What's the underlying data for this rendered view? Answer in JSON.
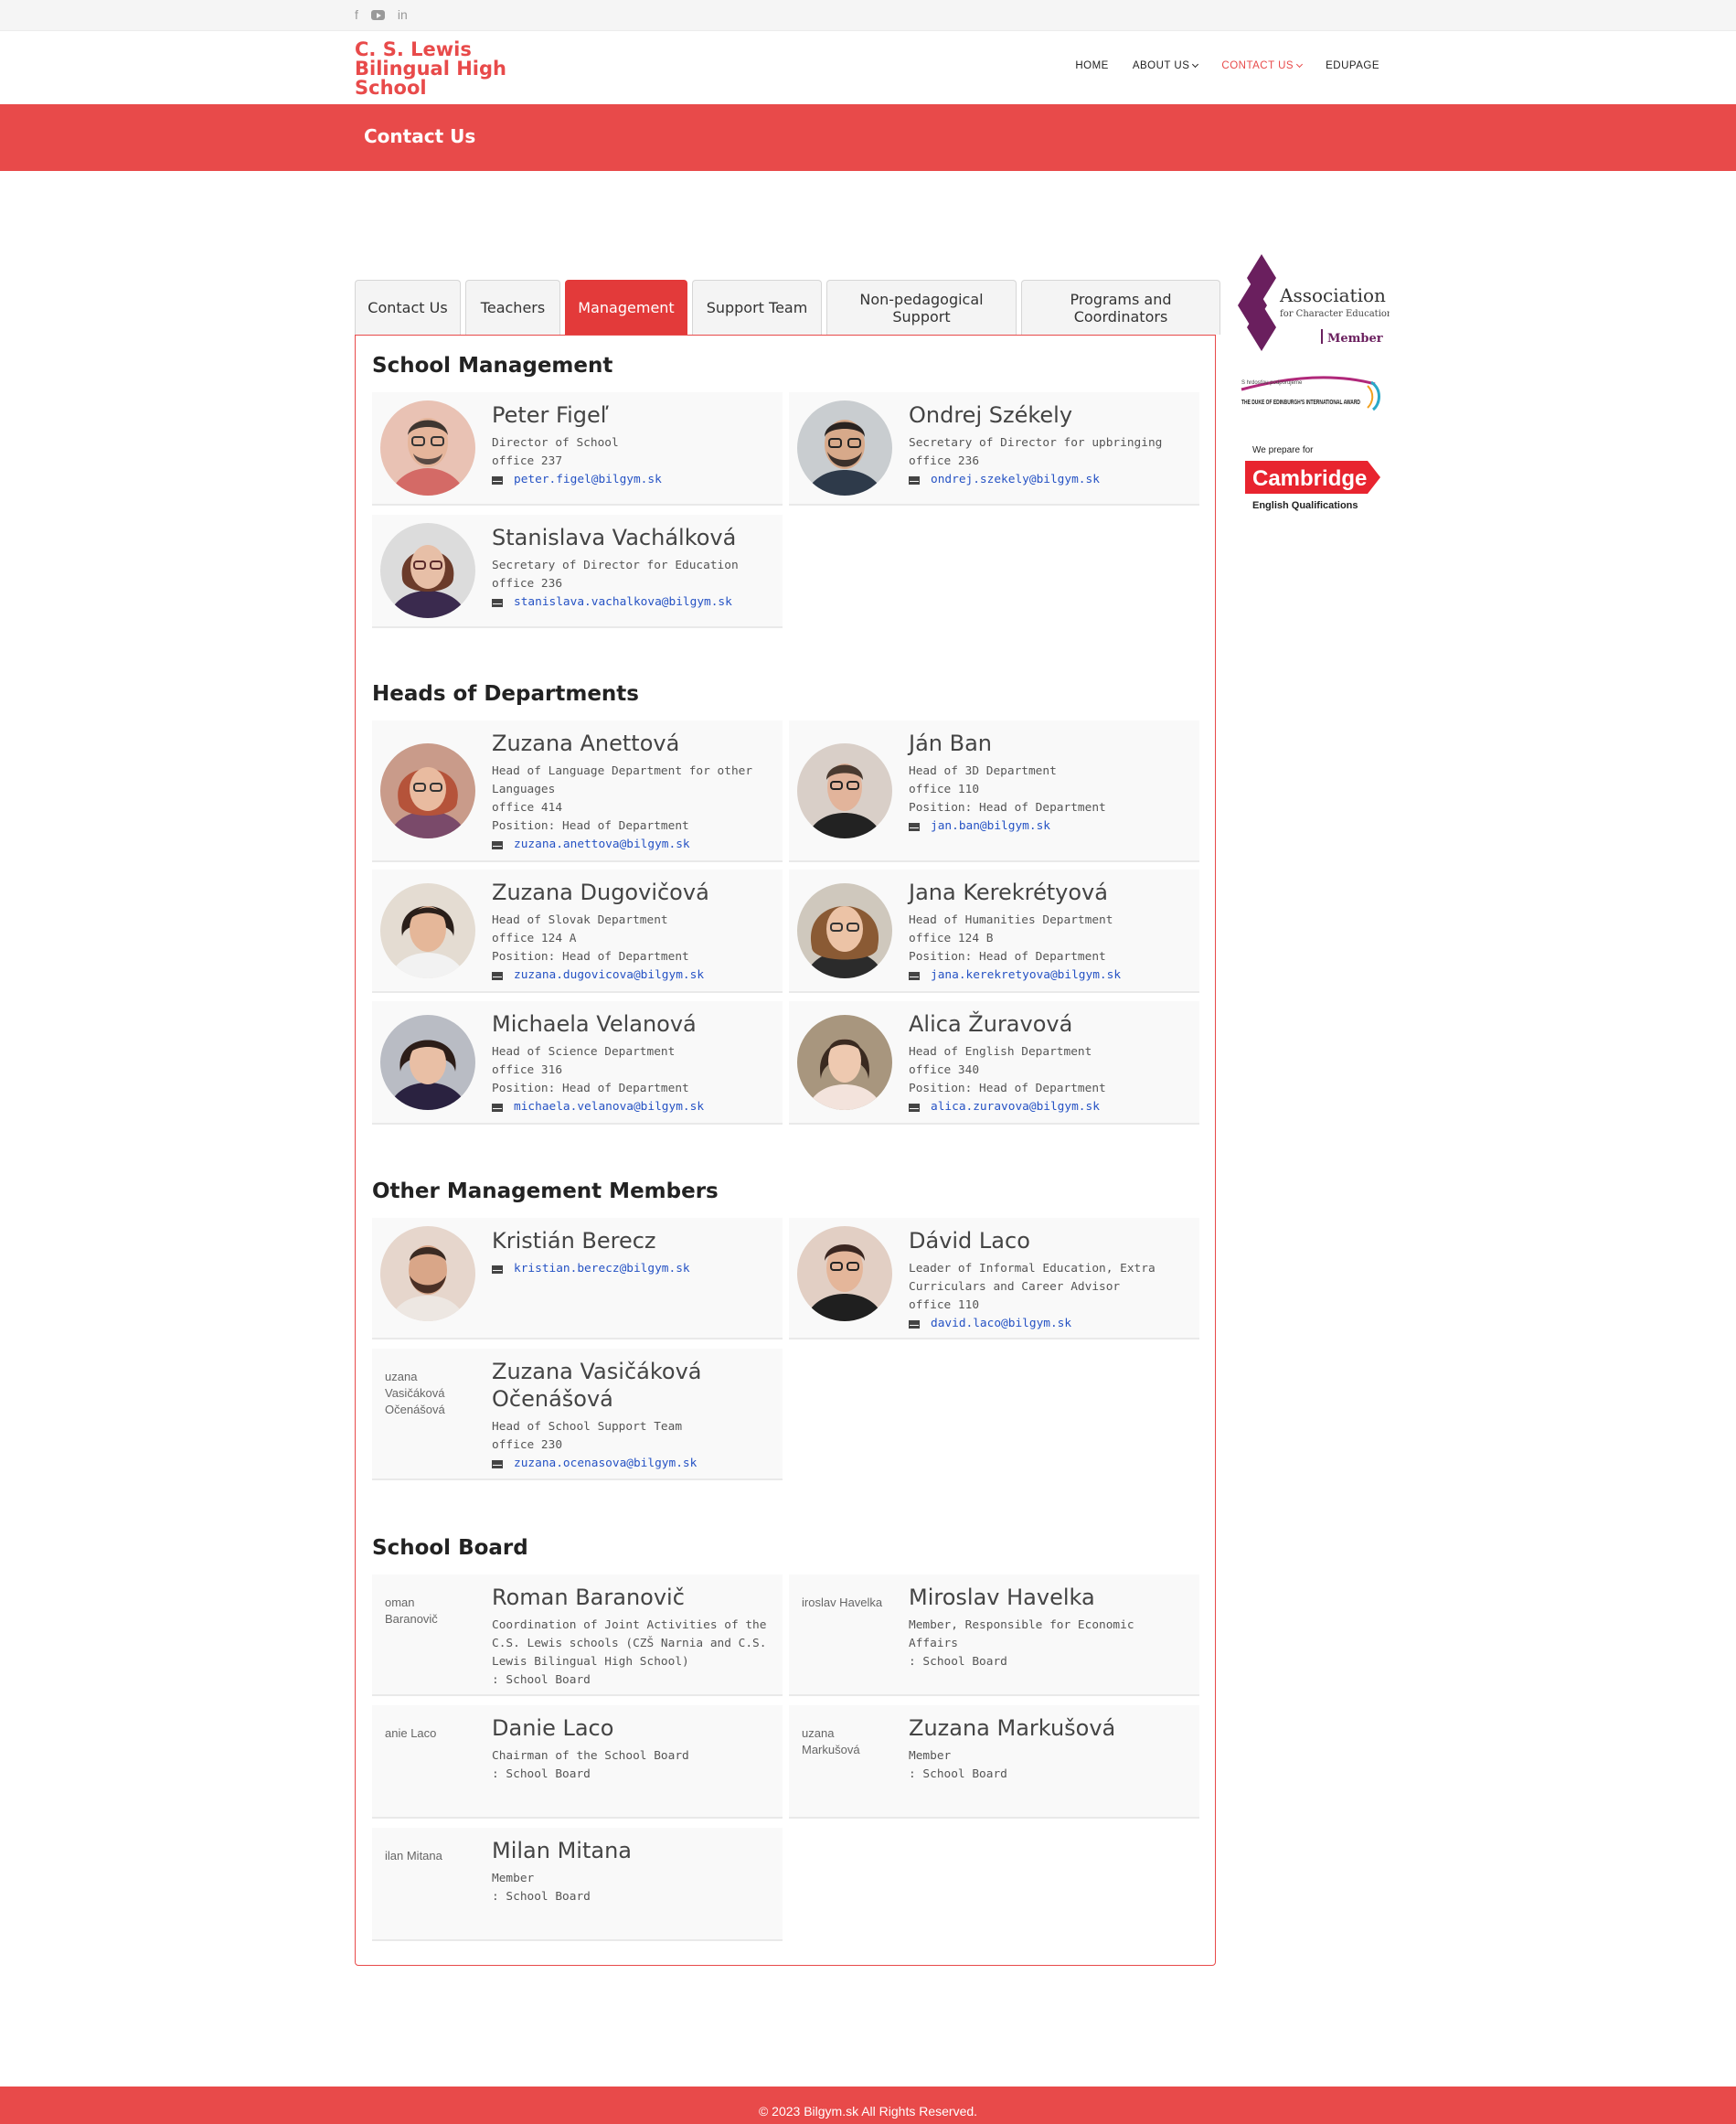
{
  "social": {
    "icons": [
      "facebook-icon",
      "youtube-icon",
      "linkedin-icon"
    ],
    "fb": "f",
    "li": "in"
  },
  "site": {
    "logo_text": "C. S. Lewis Bilingual High School"
  },
  "nav": {
    "home": "HOME",
    "about": "ABOUT US",
    "contact": "CONTACT US",
    "edupage": "EDUPAGE"
  },
  "page": {
    "title": "Contact Us"
  },
  "tabs": [
    {
      "label": "Contact Us"
    },
    {
      "label": "Teachers"
    },
    {
      "label": "Management"
    },
    {
      "label": "Support Team"
    },
    {
      "label": "Non-pedagogical Support"
    },
    {
      "label": "Programs and Coordinators"
    }
  ],
  "sections": {
    "school_management": "School Management",
    "heads": "Heads of Departments",
    "other": "Other Management Members",
    "board": "School Board"
  },
  "people": {
    "figel": {
      "name": "Peter Figeľ",
      "l1": "Director of School",
      "l2": "office 237",
      "email": "peter.figel@bilgym.sk"
    },
    "szekely": {
      "name": "Ondrej Székely",
      "l1": "Secretary of Director for upbringing",
      "l2": "office 236",
      "email": "ondrej.szekely@bilgym.sk"
    },
    "vachalkova": {
      "name": "Stanislava Vachálková",
      "l1": "Secretary of Director for Education",
      "l2": "office 236",
      "email": "stanislava.vachalkova@bilgym.sk"
    },
    "anettova": {
      "name": "Zuzana Anettová",
      "l1": "Head of Language Department for other Languages",
      "l2": "office 414",
      "l3": "Position: Head of Department",
      "email": "zuzana.anettova@bilgym.sk"
    },
    "ban": {
      "name": "Ján Ban",
      "l1": "Head of 3D Department",
      "l2": "office 110",
      "l3": "Position: Head of Department",
      "email": "jan.ban@bilgym.sk"
    },
    "dugovicova": {
      "name": "Zuzana Dugovičová",
      "l1": "Head of Slovak Department",
      "l2": "office 124 A",
      "l3": "Position: Head of Department",
      "email": "zuzana.dugovicova@bilgym.sk"
    },
    "kerekretyova": {
      "name": "Jana Kerekrétyová",
      "l1": "Head of Humanities Department",
      "l2": "office 124 B",
      "l3": "Position: Head of Department",
      "email": "jana.kerekretyova@bilgym.sk"
    },
    "velanova": {
      "name": "Michaela Velanová",
      "l1": "Head of Science Department",
      "l2": "office 316",
      "l3": "Position: Head of Department",
      "email": "michaela.velanova@bilgym.sk"
    },
    "zuravova": {
      "name": "Alica Žuravová",
      "l1": "Head of English Department",
      "l2": "office 340",
      "l3": "Position: Head of Department",
      "email": "alica.zuravova@bilgym.sk"
    },
    "berecz": {
      "name": "Kristián Berecz",
      "email": "kristian.berecz@bilgym.sk"
    },
    "laco": {
      "name": "Dávid Laco",
      "l1": "Leader of Informal Education, Extra Curriculars and Career Advisor",
      "l2": "office 110",
      "email": "david.laco@bilgym.sk"
    },
    "ocenasova": {
      "name": "Zuzana Vasičáková Očenášová",
      "alt": "uzana Vasičáková Očenášová",
      "l1": "Head of School Support Team",
      "l2": "office 230",
      "email": "zuzana.ocenasova@bilgym.sk"
    },
    "baranovic": {
      "name": "Roman Baranovič",
      "alt": "oman Baranovič",
      "l1": "Coordination of Joint Activities of the C.S. Lewis schools (CZŠ Narnia and C.S. Lewis Bilingual High School)",
      "l2": ": School Board"
    },
    "havelka": {
      "name": "Miroslav Havelka",
      "alt": "iroslav Havelka",
      "l1": "Member, Responsible for Economic Affairs",
      "l2": ": School Board"
    },
    "dlaco": {
      "name": "Danie Laco",
      "alt": "anie Laco",
      "l1": "Chairman of the School Board",
      "l2": ": School Board"
    },
    "markusova": {
      "name": "Zuzana Markušová",
      "alt": "uzana Markušová",
      "l1": "Member",
      "l2": ": School Board"
    },
    "mitana": {
      "name": "Milan Mitana",
      "alt": "ilan Mitana",
      "l1": "Member",
      "l2": ": School Board"
    }
  },
  "sidebar": {
    "ace_title": "Association",
    "ace_sub": "for Character Education",
    "ace_member": "Member",
    "dofe_small": "S hrdosťou podporujeme",
    "dofe_main": "THE DUKE OF EDINBURGH'S INTERNATIONAL AWARD",
    "cam_top": "We prepare for",
    "cam_name": "Cambridge",
    "cam_bottom": "English Qualifications"
  },
  "footer": {
    "text": "© 2023 Bilgym.sk All Rights Reserved."
  },
  "colors": {
    "brand": "#e84a4a",
    "tab_active": "#e33a3a",
    "link": "#2552c4"
  }
}
